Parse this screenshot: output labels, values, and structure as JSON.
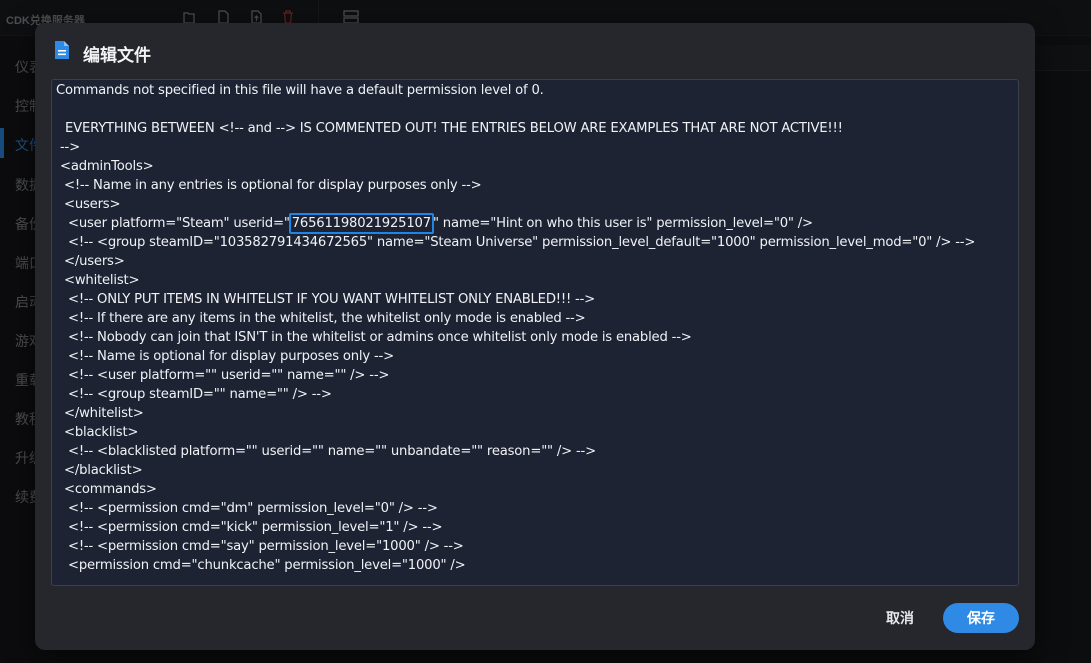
{
  "app": {
    "title": "CDK兑换服务器",
    "sidebar_items": [
      "仪表",
      "控制",
      "文件",
      "数据",
      "备份",
      "端口",
      "启动",
      "游戏",
      "重载",
      "教程",
      "升级",
      "续费"
    ],
    "active_sidebar_index": 2
  },
  "dialog": {
    "title": "编辑文件",
    "icon": "file-text-icon",
    "cancel_label": "取消",
    "save_label": "保存",
    "accent_color": "#2f8ae5"
  },
  "editor": {
    "lines": [
      " Commands not specified in this file will have a default permission level of 0.",
      "",
      " EVERYTHING BETWEEN <!-- and --> IS COMMENTED OUT! THE ENTRIES BELOW ARE EXAMPLES THAT ARE NOT ACTIVE!!!",
      "-->",
      "<adminTools>",
      " <!-- Name in any entries is optional for display purposes only -->",
      " <users>",
      "  <user platform=\"Steam\" userid=\"",
      "  <!-- <group steamID=\"103582791434672565\" name=\"Steam Universe\" permission_level_default=\"1000\" permission_level_mod=\"0\" /> -->",
      " </users>",
      " <whitelist>",
      "  <!-- ONLY PUT ITEMS IN WHITELIST IF YOU WANT WHITELIST ONLY ENABLED!!! -->",
      "  <!-- If there are any items in the whitelist, the whitelist only mode is enabled -->",
      "  <!-- Nobody can join that ISN'T in the whitelist or admins once whitelist only mode is enabled -->",
      "  <!-- Name is optional for display purposes only -->",
      "  <!-- <user platform=\"\" userid=\"\" name=\"\" /> -->",
      "  <!-- <group steamID=\"\" name=\"\" /> -->",
      " </whitelist>",
      " <blacklist>",
      "  <!-- <blacklisted platform=\"\" userid=\"\" name=\"\" unbandate=\"\" reason=\"\" /> -->",
      " </blacklist>",
      " <commands>",
      "  <!-- <permission cmd=\"dm\" permission_level=\"0\" /> -->",
      "  <!-- <permission cmd=\"kick\" permission_level=\"1\" /> -->",
      "  <!-- <permission cmd=\"say\" permission_level=\"1000\" /> -->",
      "  <permission cmd=\"chunkcache\" permission_level=\"1000\" />"
    ],
    "highlighted_userid": "76561198021925107",
    "user_line_suffix": "\" name=\"Hint on who this user is\" permission_level=\"0\" />"
  }
}
